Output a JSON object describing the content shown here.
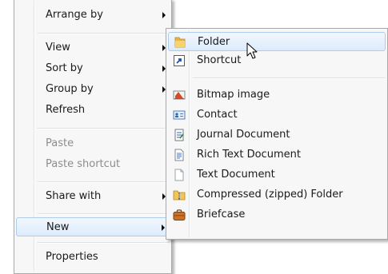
{
  "context_menu": {
    "items": [
      {
        "label": "Arrange by"
      },
      {
        "label": "View"
      },
      {
        "label": "Sort by"
      },
      {
        "label": "Group by"
      },
      {
        "label": "Refresh"
      },
      {
        "label": "Paste"
      },
      {
        "label": "Paste shortcut"
      },
      {
        "label": "Share with"
      },
      {
        "label": "New"
      },
      {
        "label": "Properties"
      }
    ]
  },
  "new_submenu": {
    "items": [
      {
        "label": "Folder",
        "icon": "folder-icon"
      },
      {
        "label": "Shortcut",
        "icon": "shortcut-icon"
      },
      {
        "label": "Bitmap image",
        "icon": "bitmap-image-icon"
      },
      {
        "label": "Contact",
        "icon": "contact-card-icon"
      },
      {
        "label": "Journal Document",
        "icon": "journal-document-icon"
      },
      {
        "label": "Rich Text Document",
        "icon": "rich-text-document-icon"
      },
      {
        "label": "Text Document",
        "icon": "text-document-icon"
      },
      {
        "label": "Compressed (zipped) Folder",
        "icon": "zipped-folder-icon"
      },
      {
        "label": "Briefcase",
        "icon": "briefcase-icon"
      }
    ]
  },
  "highlight_color": "#dcebfc",
  "disabled_text_color": "#8d8d8d",
  "pointer": {
    "icon": "mouse-pointer-icon"
  }
}
